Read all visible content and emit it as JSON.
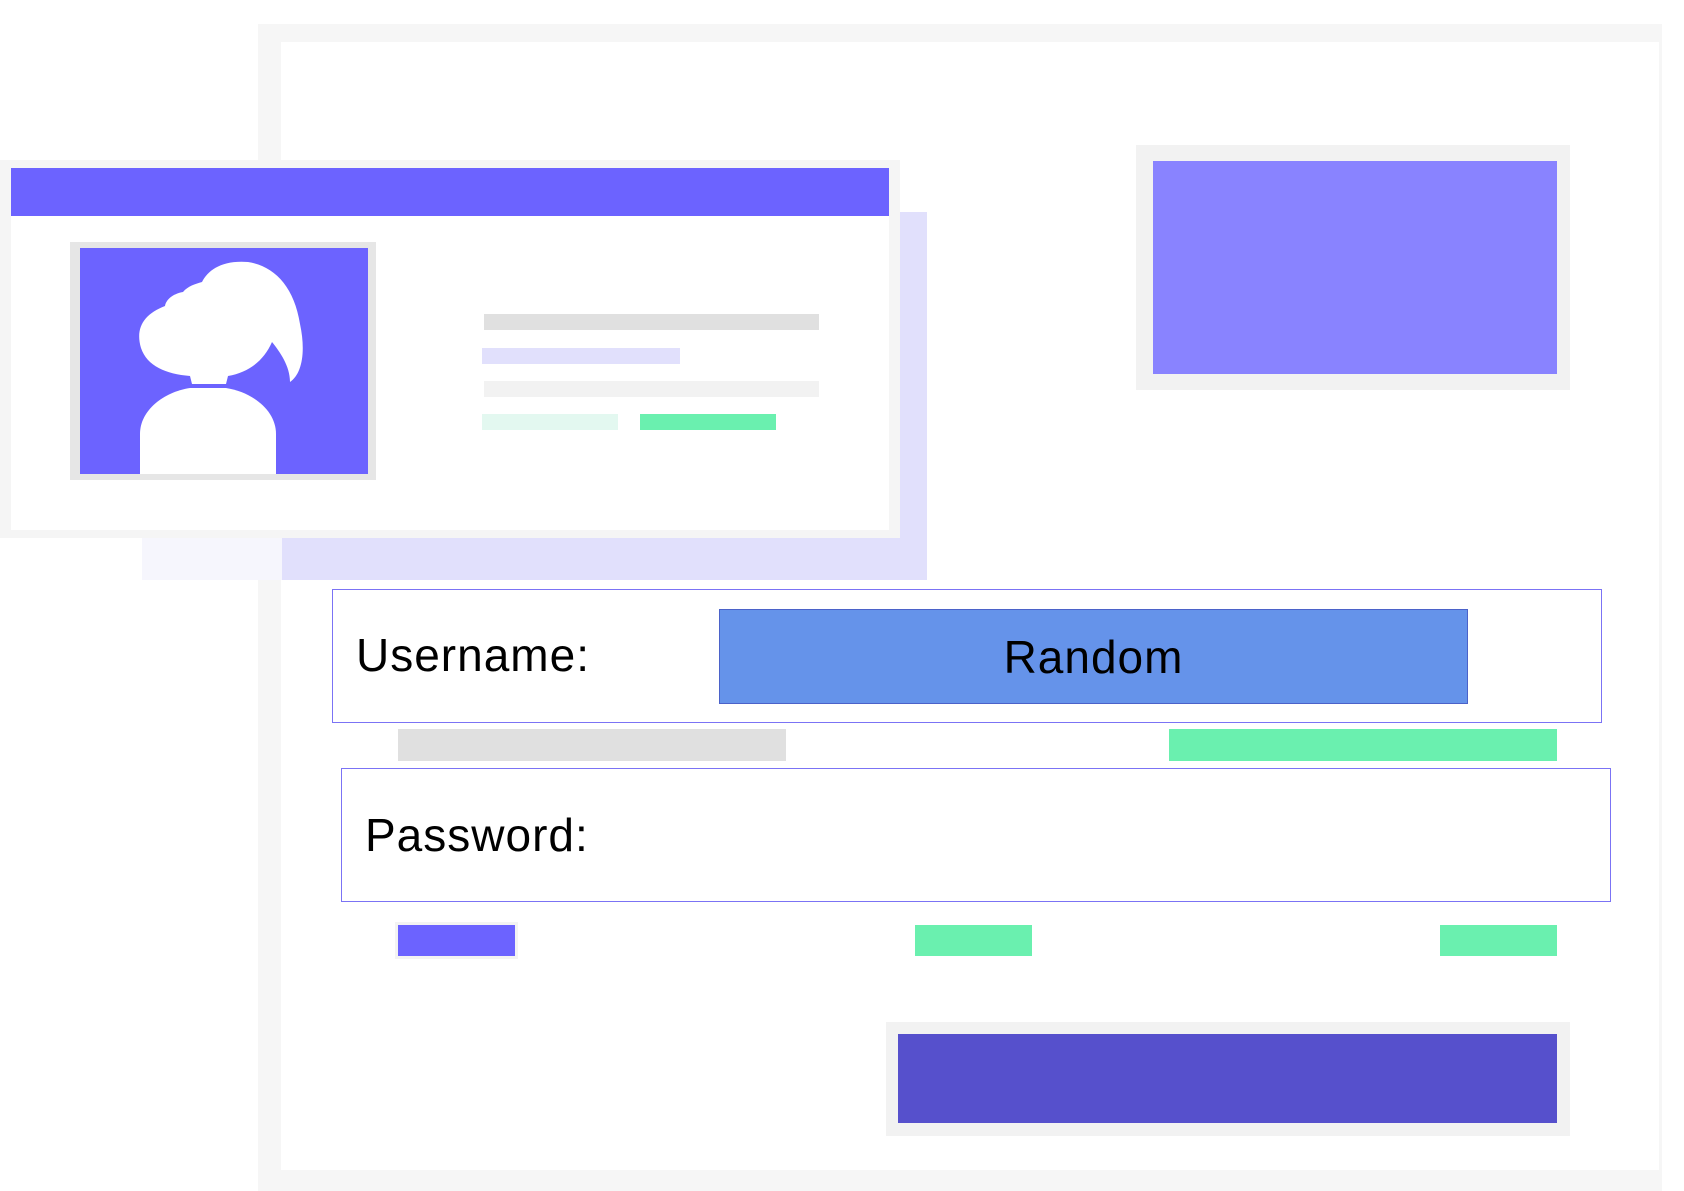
{
  "form": {
    "username_label": "Username:",
    "username_value": "Random",
    "password_label": "Password:",
    "password_value": ""
  },
  "profile_card": {
    "avatar": "female-user-avatar-icon"
  },
  "colors": {
    "accent": "#6c63ff",
    "accent_light": "#8983ff",
    "accent_dark": "#5650cc",
    "green": "#6af0af",
    "username_field": "#6593ea",
    "border": "#7b73f5"
  }
}
